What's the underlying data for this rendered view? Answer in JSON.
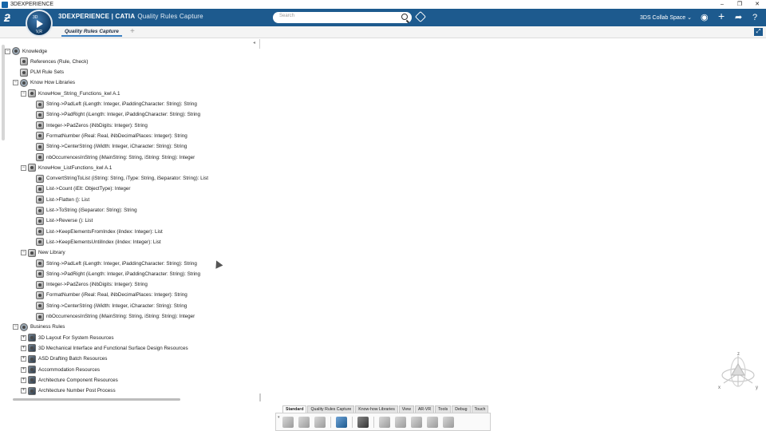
{
  "window": {
    "title": "3DEXPERIENCE",
    "controls": [
      "–",
      "❐",
      "✕"
    ]
  },
  "header": {
    "brand": "3DEXPERIENCE | CATIA",
    "app_name": "Quality Rules Capture",
    "compass_top": "3D",
    "compass_version": "V,R",
    "search_placeholder": "Search",
    "collab_space": "3DS Collab Space",
    "icons": [
      "ds-logo-icon",
      "compass-icon",
      "search-icon",
      "tag-icon",
      "user-icon",
      "add-icon",
      "share-icon",
      "help-icon"
    ]
  },
  "tabs": {
    "active": "Quality Rules Capture",
    "add": "+"
  },
  "tree": {
    "nodes": [
      {
        "label": "Knowledge",
        "level": 0,
        "toggle": "−",
        "icon": "grp"
      },
      {
        "label": "References (Rule, Check)",
        "level": 1,
        "toggle": "",
        "icon": "item"
      },
      {
        "label": "PLM Rule Sets",
        "level": 1,
        "toggle": "",
        "icon": "item"
      },
      {
        "label": "Know How Libraries",
        "level": 1,
        "toggle": "−",
        "icon": "grp"
      },
      {
        "label": "KnowHow_String_Functions_kwl A.1",
        "level": 2,
        "toggle": "−",
        "icon": "item"
      },
      {
        "label": "String->PadLeft (iLength: Integer, iPaddingCharacter: String): String",
        "level": 3,
        "toggle": "",
        "icon": "item"
      },
      {
        "label": "String->PadRight (iLength: Integer, iPaddingCharacter: String): String",
        "level": 3,
        "toggle": "",
        "icon": "item"
      },
      {
        "label": "Integer->PadZeros (iNbDigits: Integer): String",
        "level": 3,
        "toggle": "",
        "icon": "item"
      },
      {
        "label": "FormatNumber (iReal: Real, iNbDecimalPlaces: Integer): String",
        "level": 3,
        "toggle": "",
        "icon": "item"
      },
      {
        "label": "String->CenterString (iWidth: Integer, iCharacter: String): String",
        "level": 3,
        "toggle": "",
        "icon": "item"
      },
      {
        "label": "nbOccurrencesInString (iMainString: String, iString: String): Integer",
        "level": 3,
        "toggle": "",
        "icon": "item"
      },
      {
        "label": "KnowHow_ListFunctions_kwl A.1",
        "level": 2,
        "toggle": "−",
        "icon": "item"
      },
      {
        "label": "ConvertStringToList (iString: String, iType: String, iSeparator: String): List",
        "level": 3,
        "toggle": "",
        "icon": "item"
      },
      {
        "label": "List->Count (iElt: ObjectType): Integer",
        "level": 3,
        "toggle": "",
        "icon": "item"
      },
      {
        "label": "List->Flatten (): List",
        "level": 3,
        "toggle": "",
        "icon": "item"
      },
      {
        "label": "List->ToString (iSeparator: String): String",
        "level": 3,
        "toggle": "",
        "icon": "item"
      },
      {
        "label": "List->Reverse (): List",
        "level": 3,
        "toggle": "",
        "icon": "item"
      },
      {
        "label": "List->KeepElementsFromIndex (iIndex: Integer): List",
        "level": 3,
        "toggle": "",
        "icon": "item"
      },
      {
        "label": "List->KeepElementsUntilIndex (iIndex: Integer): List",
        "level": 3,
        "toggle": "",
        "icon": "item"
      },
      {
        "label": "New Library",
        "level": 2,
        "toggle": "−",
        "icon": "item"
      },
      {
        "label": "String->PadLeft (iLength: Integer, iPaddingCharacter: String): String",
        "level": 3,
        "toggle": "",
        "icon": "item"
      },
      {
        "label": "String->PadRight (iLength: Integer, iPaddingCharacter: String): String",
        "level": 3,
        "toggle": "",
        "icon": "item"
      },
      {
        "label": "Integer->PadZeros (iNbDigits: Integer): String",
        "level": 3,
        "toggle": "",
        "icon": "item"
      },
      {
        "label": "FormatNumber (iReal: Real, iNbDecimalPlaces: Integer): String",
        "level": 3,
        "toggle": "",
        "icon": "item"
      },
      {
        "label": "String->CenterString (iWidth: Integer, iCharacter: String): String",
        "level": 3,
        "toggle": "",
        "icon": "item"
      },
      {
        "label": "nbOccurrencesInString (iMainString: String, iString: String): Integer",
        "level": 3,
        "toggle": "",
        "icon": "item"
      },
      {
        "label": "Business Rules",
        "level": 1,
        "toggle": "−",
        "icon": "grp"
      },
      {
        "label": "3D Layout For System Resources",
        "level": 2,
        "toggle": "+",
        "icon": "biz"
      },
      {
        "label": "3D Mechanical Interface and Functional Surface Design Resources",
        "level": 2,
        "toggle": "+",
        "icon": "biz"
      },
      {
        "label": "ASD Drafting Batch Resources",
        "level": 2,
        "toggle": "+",
        "icon": "biz"
      },
      {
        "label": "Accommodation Resources",
        "level": 2,
        "toggle": "+",
        "icon": "biz"
      },
      {
        "label": "Architecture Component Resources",
        "level": 2,
        "toggle": "+",
        "icon": "biz"
      },
      {
        "label": "Architecture Number Post Process",
        "level": 2,
        "toggle": "+",
        "icon": "biz"
      }
    ]
  },
  "compass_axes": {
    "z": "z",
    "x": "x",
    "y": "y"
  },
  "action_bar": {
    "tabs": [
      "Standard",
      "Quality Rules Capture",
      "Know-how Libraries",
      "View",
      "AR-VR",
      "Tools",
      "Debug",
      "Touch"
    ],
    "active_tab": "Standard",
    "tools": [
      "cut-icon",
      "copy-icon",
      "paste-icon",
      "undo-icon",
      "zoom-fit-icon",
      "rule-icon",
      "check-icon",
      "library-icon",
      "function-icon",
      "settings-icon"
    ]
  }
}
